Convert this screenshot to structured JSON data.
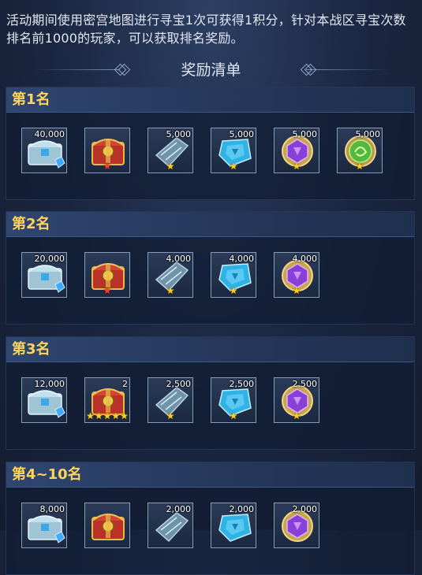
{
  "description": "活动期间使用密宫地图进行寻宝1次可获得1积分，针对本战区寻宝次数排名前1000的玩家，可以获取排名奖励。",
  "list_title": "奖励清单",
  "ranks": [
    {
      "label": "第1名",
      "items": [
        {
          "icon": "silver-chest-icon",
          "count": "40,000",
          "stars": "",
          "star_color": ""
        },
        {
          "icon": "golden-red-chest-icon",
          "count": "",
          "stars": "★",
          "star_color": "red"
        },
        {
          "icon": "scroll-stone-icon",
          "count": "5,000",
          "stars": "★",
          "star_color": "gold"
        },
        {
          "icon": "blue-gem-icon",
          "count": "5,000",
          "stars": "★",
          "star_color": "gold"
        },
        {
          "icon": "purple-gem-icon",
          "count": "5,000",
          "stars": "★",
          "star_color": "gold"
        },
        {
          "icon": "green-gem-icon",
          "count": "5,000",
          "stars": "★",
          "star_color": "gold"
        }
      ]
    },
    {
      "label": "第2名",
      "items": [
        {
          "icon": "silver-chest-icon",
          "count": "20,000",
          "stars": "",
          "star_color": ""
        },
        {
          "icon": "golden-red-chest-icon",
          "count": "",
          "stars": "★",
          "star_color": "red"
        },
        {
          "icon": "scroll-stone-icon",
          "count": "4,000",
          "stars": "★",
          "star_color": "gold"
        },
        {
          "icon": "blue-gem-icon",
          "count": "4,000",
          "stars": "★",
          "star_color": "gold"
        },
        {
          "icon": "purple-gem-icon",
          "count": "4,000",
          "stars": "★",
          "star_color": "gold"
        }
      ]
    },
    {
      "label": "第3名",
      "items": [
        {
          "icon": "silver-chest-icon",
          "count": "12,000",
          "stars": "",
          "star_color": ""
        },
        {
          "icon": "golden-red-chest-icon",
          "count": "2",
          "stars": "★★★★★",
          "star_color": "gold"
        },
        {
          "icon": "scroll-stone-icon",
          "count": "2,500",
          "stars": "★",
          "star_color": "gold"
        },
        {
          "icon": "blue-gem-icon",
          "count": "2,500",
          "stars": "★",
          "star_color": "gold"
        },
        {
          "icon": "purple-gem-icon",
          "count": "2,500",
          "stars": "★",
          "star_color": "gold"
        }
      ]
    },
    {
      "label": "第4~10名",
      "items": [
        {
          "icon": "silver-chest-icon",
          "count": "8,000",
          "stars": "",
          "star_color": ""
        },
        {
          "icon": "golden-red-chest-icon",
          "count": "",
          "stars": "",
          "star_color": ""
        },
        {
          "icon": "scroll-stone-icon",
          "count": "2,000",
          "stars": "",
          "star_color": ""
        },
        {
          "icon": "blue-gem-icon",
          "count": "2,000",
          "stars": "",
          "star_color": ""
        },
        {
          "icon": "purple-gem-icon",
          "count": "2,000",
          "stars": "",
          "star_color": ""
        }
      ]
    }
  ],
  "colors": {
    "rank_label": "#ffd45a",
    "star_gold": "#ffd21e",
    "star_red": "#ff3b3b",
    "header_bg": "#2f4670"
  }
}
